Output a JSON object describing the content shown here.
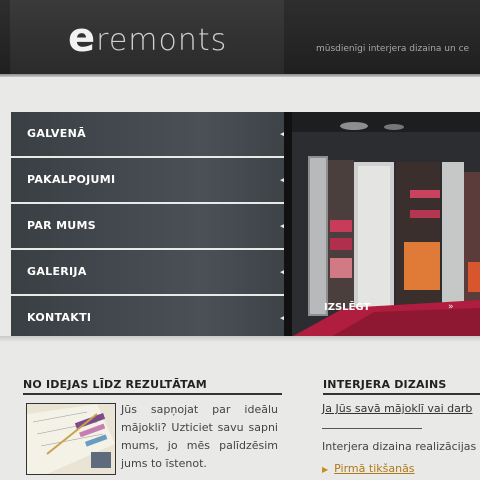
{
  "header": {
    "logo_e": "e",
    "logo_rest": "remonts",
    "tagline": "mūsdienīgi interjera dizaina un ce"
  },
  "nav": {
    "items": [
      {
        "label": "GALVENĀ"
      },
      {
        "label": "PAKALPOJUMI"
      },
      {
        "label": "PAR MUMS"
      },
      {
        "label": "GALERIJA"
      },
      {
        "label": "KONTAKTI"
      }
    ]
  },
  "hero": {
    "label": "IZSLĒGT"
  },
  "section1": {
    "title": "NO IDEJAS LĪDZ REZULTĀTAM",
    "text": "Jūs sapņojat par ideālu mājokli? Uzticiet savu sapni mums, jo mēs palīdzēsim jums to īstenot."
  },
  "section2": {
    "title": "INTERJERA DIZAINS",
    "link": "Ja Jūs savā mājoklī vai darb",
    "text": "Interjera dizaina realizācijas",
    "bullet": "Pirmā tikšanās"
  },
  "colors": {
    "nav_bg": "#454a50",
    "accent": "#c98d1c",
    "header_bg": "#262626"
  }
}
